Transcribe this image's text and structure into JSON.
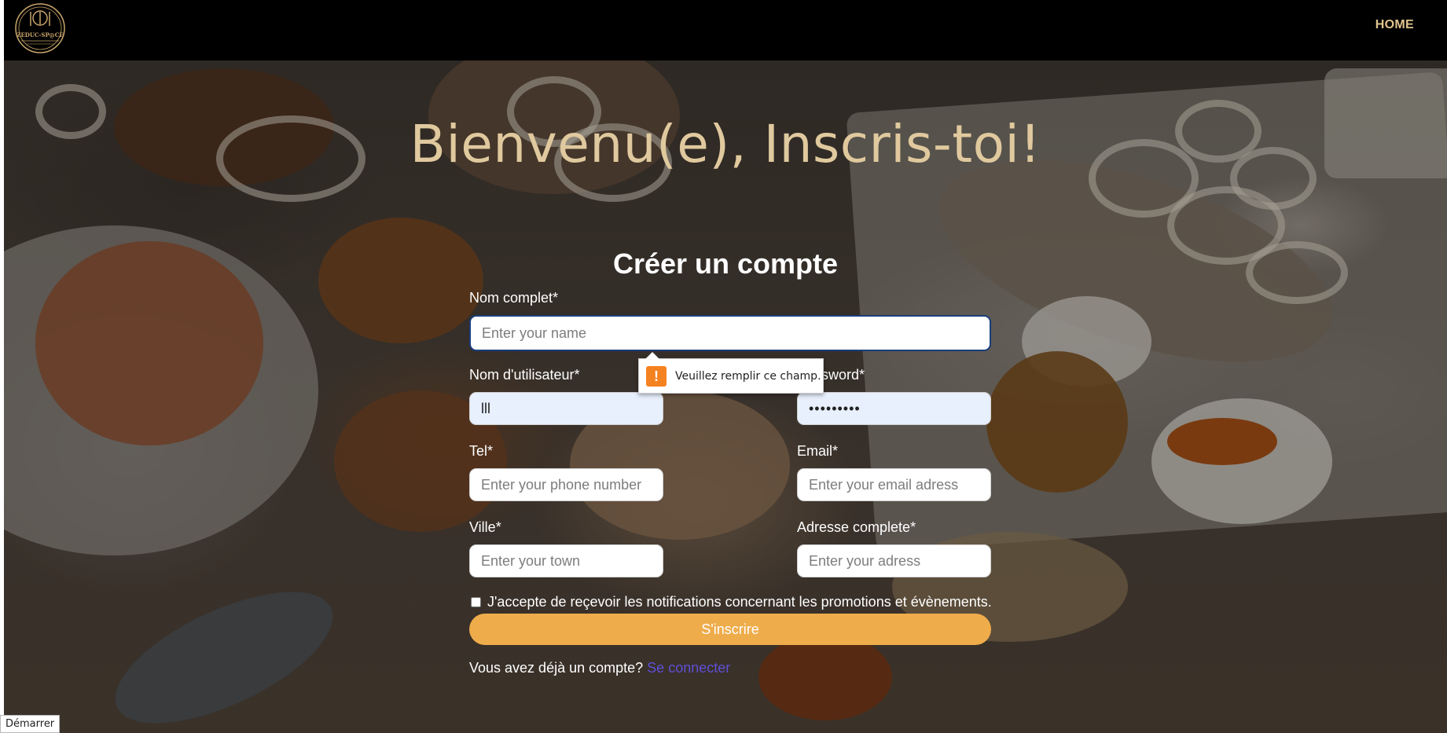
{
  "navbar": {
    "logo_text": "ZEDUC-SP@CE",
    "home_label": "HOME"
  },
  "hero": {
    "welcome_title": "Bienvenu(e), Inscris-toi!"
  },
  "form": {
    "title": "Créer un compte",
    "full_name": {
      "label": "Nom complet*",
      "placeholder": "Enter your name",
      "value": ""
    },
    "username": {
      "label": "Nom d'utilisateur*",
      "value": "lll"
    },
    "password": {
      "label": "Password*",
      "value": "•••••••••"
    },
    "phone": {
      "label": "Tel*",
      "placeholder": "Enter your phone number",
      "value": ""
    },
    "email": {
      "label": "Email*",
      "placeholder": "Enter your email adress",
      "value": ""
    },
    "town": {
      "label": "Ville*",
      "placeholder": "Enter your town",
      "value": ""
    },
    "address": {
      "label": "Adresse complete*",
      "placeholder": "Enter your adress",
      "value": ""
    },
    "notifications_consent": "J'accepte de reçevoir les notifications concernant les promotions et évènements.",
    "submit_label": "S'inscrire",
    "login_prompt": "Vous avez déjà un compte?",
    "login_link": "Se connecter"
  },
  "validation_tooltip": {
    "icon": "!",
    "message": "Veuillez remplir ce champ."
  },
  "taskbar": {
    "start_label": "Démarrer"
  },
  "colors": {
    "navbar_bg": "#000000",
    "accent_gold": "#e0c48e",
    "submit_orange": "#efac4b",
    "link_purple": "#5e4fd8",
    "warning_orange": "#f58220"
  }
}
